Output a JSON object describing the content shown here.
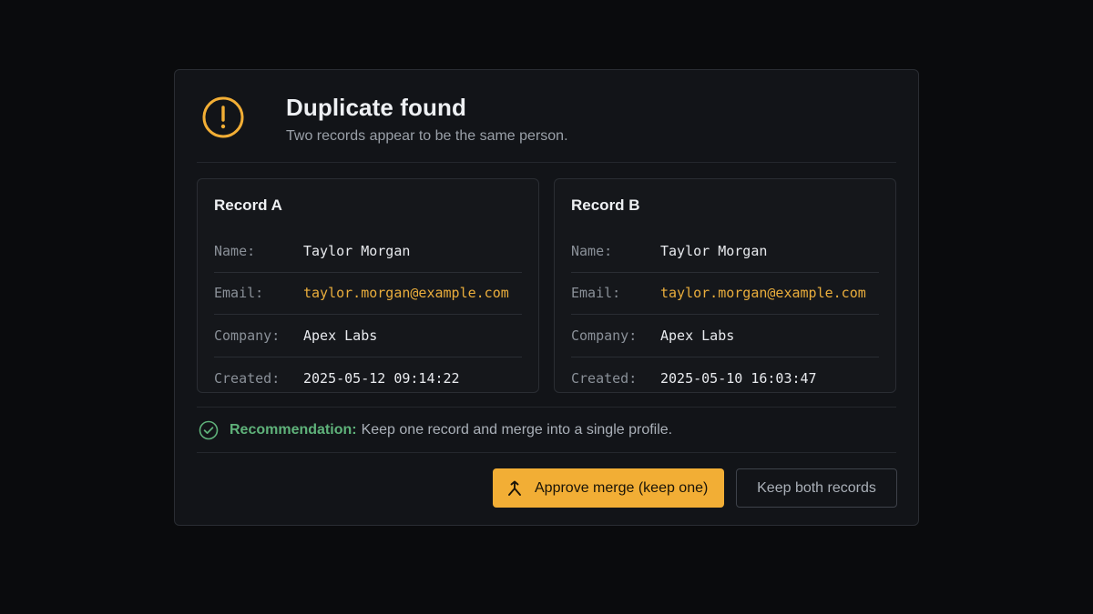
{
  "dialog": {
    "title": "Duplicate found",
    "subtitle": "Two records appear to be the same person.",
    "icons": {
      "alert": "alert-circle-icon",
      "check": "check-circle-icon",
      "merge": "merge-icon"
    },
    "colors": {
      "accent": "#f2ae35",
      "success": "#5fb27a",
      "email": "#e9ad3c"
    }
  },
  "records": [
    {
      "title": "Record A",
      "fields": [
        {
          "label": "Name:",
          "value": "Taylor Morgan"
        },
        {
          "label": "Email:",
          "value": "taylor.morgan@example.com"
        },
        {
          "label": "Company:",
          "value": "Apex Labs"
        },
        {
          "label": "Created:",
          "value": "2025-05-12 09:14:22"
        }
      ]
    },
    {
      "title": "Record B",
      "fields": [
        {
          "label": "Name:",
          "value": "Taylor Morgan"
        },
        {
          "label": "Email:",
          "value": "taylor.morgan@example.com"
        },
        {
          "label": "Company:",
          "value": "Apex Labs"
        },
        {
          "label": "Created:",
          "value": "2025-05-10 16:03:47"
        }
      ]
    }
  ],
  "recommendation": {
    "label": "Recommendation:",
    "text": "Keep one record and merge into a single profile."
  },
  "actions": {
    "approve_label": "Approve merge (keep one)",
    "keep_label": "Keep both records"
  }
}
